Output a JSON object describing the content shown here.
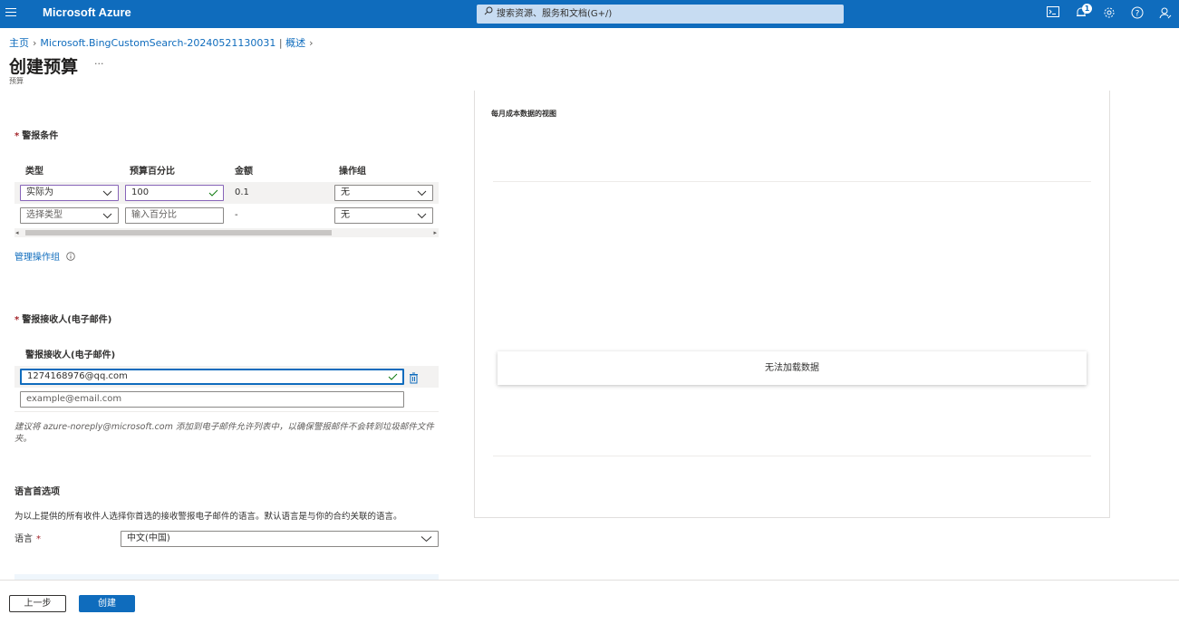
{
  "topbar": {
    "menu_icon": "hamburger-icon",
    "brand": "Microsoft Azure",
    "search_placeholder": "搜索资源、服务和文档(G+/)",
    "notification_count": "1",
    "icons": [
      "cloud-shell-icon",
      "notifications-icon",
      "settings-icon",
      "help-icon",
      "feedback-icon"
    ]
  },
  "breadcrumb": {
    "home": "主页",
    "resource": "Microsoft.BingCustomSearch-20240521130031",
    "divider": "|",
    "overview": "概述"
  },
  "page": {
    "title": "创建预算",
    "more": "···",
    "subtitle": "预算"
  },
  "alert_conditions": {
    "title": "警报条件",
    "columns": [
      "类型",
      "预算百分比",
      "金额",
      "操作组"
    ],
    "rows": [
      {
        "type": "实际为",
        "percent": "100",
        "amount": "0.1",
        "action_group": "无"
      },
      {
        "type_placeholder": "选择类型",
        "percent_placeholder": "输入百分比",
        "amount": "-",
        "action_group": "无"
      }
    ],
    "manage_link": "管理操作组"
  },
  "recipients": {
    "title": "警报接收人(电子邮件)",
    "column": "警报接收人(电子邮件)",
    "email_value": "1274168976@qq.com",
    "email_placeholder": "example@email.com",
    "note": "建议将 azure-noreply@microsoft.com 添加到电子邮件允许列表中，以确保警报邮件不会转到垃圾邮件文件夹。"
  },
  "language": {
    "title": "语言首选项",
    "description": "为以上提供的所有收件人选择你首选的接收警报电子邮件的语言。默认语言是与你的合约关联的语言。",
    "label": "语言",
    "selected": "中文(中国)"
  },
  "chart_panel": {
    "title": "每月成本数据的视图",
    "no_data": "无法加载数据"
  },
  "footer": {
    "back": "上一步",
    "create": "创建"
  },
  "colors": {
    "brand_blue": "#0f6cbd",
    "required_red": "#a4262c",
    "valid_green": "#107c10"
  }
}
